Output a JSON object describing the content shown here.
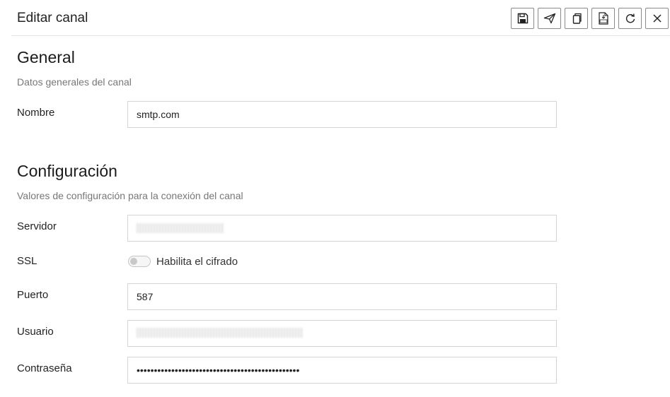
{
  "header": {
    "title": "Editar canal",
    "toolbar": [
      {
        "name": "save-button",
        "icon": "save-icon"
      },
      {
        "name": "send-button",
        "icon": "send-icon"
      },
      {
        "name": "duplicate-button",
        "icon": "copy-icon"
      },
      {
        "name": "export-csv-button",
        "icon": "csv-file-icon"
      },
      {
        "name": "refresh-button",
        "icon": "refresh-icon"
      },
      {
        "name": "close-button",
        "icon": "close-icon"
      }
    ]
  },
  "general": {
    "title": "General",
    "description": "Datos generales del canal",
    "nombre_label": "Nombre",
    "nombre_value": "smtp.com"
  },
  "config": {
    "title": "Configuración",
    "description": "Valores de configuración para la conexión del canal",
    "servidor_label": "Servidor",
    "ssl_label": "SSL",
    "ssl_toggle_text": "Habilita el cifrado",
    "ssl_enabled": false,
    "puerto_label": "Puerto",
    "puerto_value": "587",
    "usuario_label": "Usuario",
    "contrasena_label": "Contraseña",
    "contrasena_value": "•••••••••••••••••••••••••••••••••••••••••••••••"
  }
}
